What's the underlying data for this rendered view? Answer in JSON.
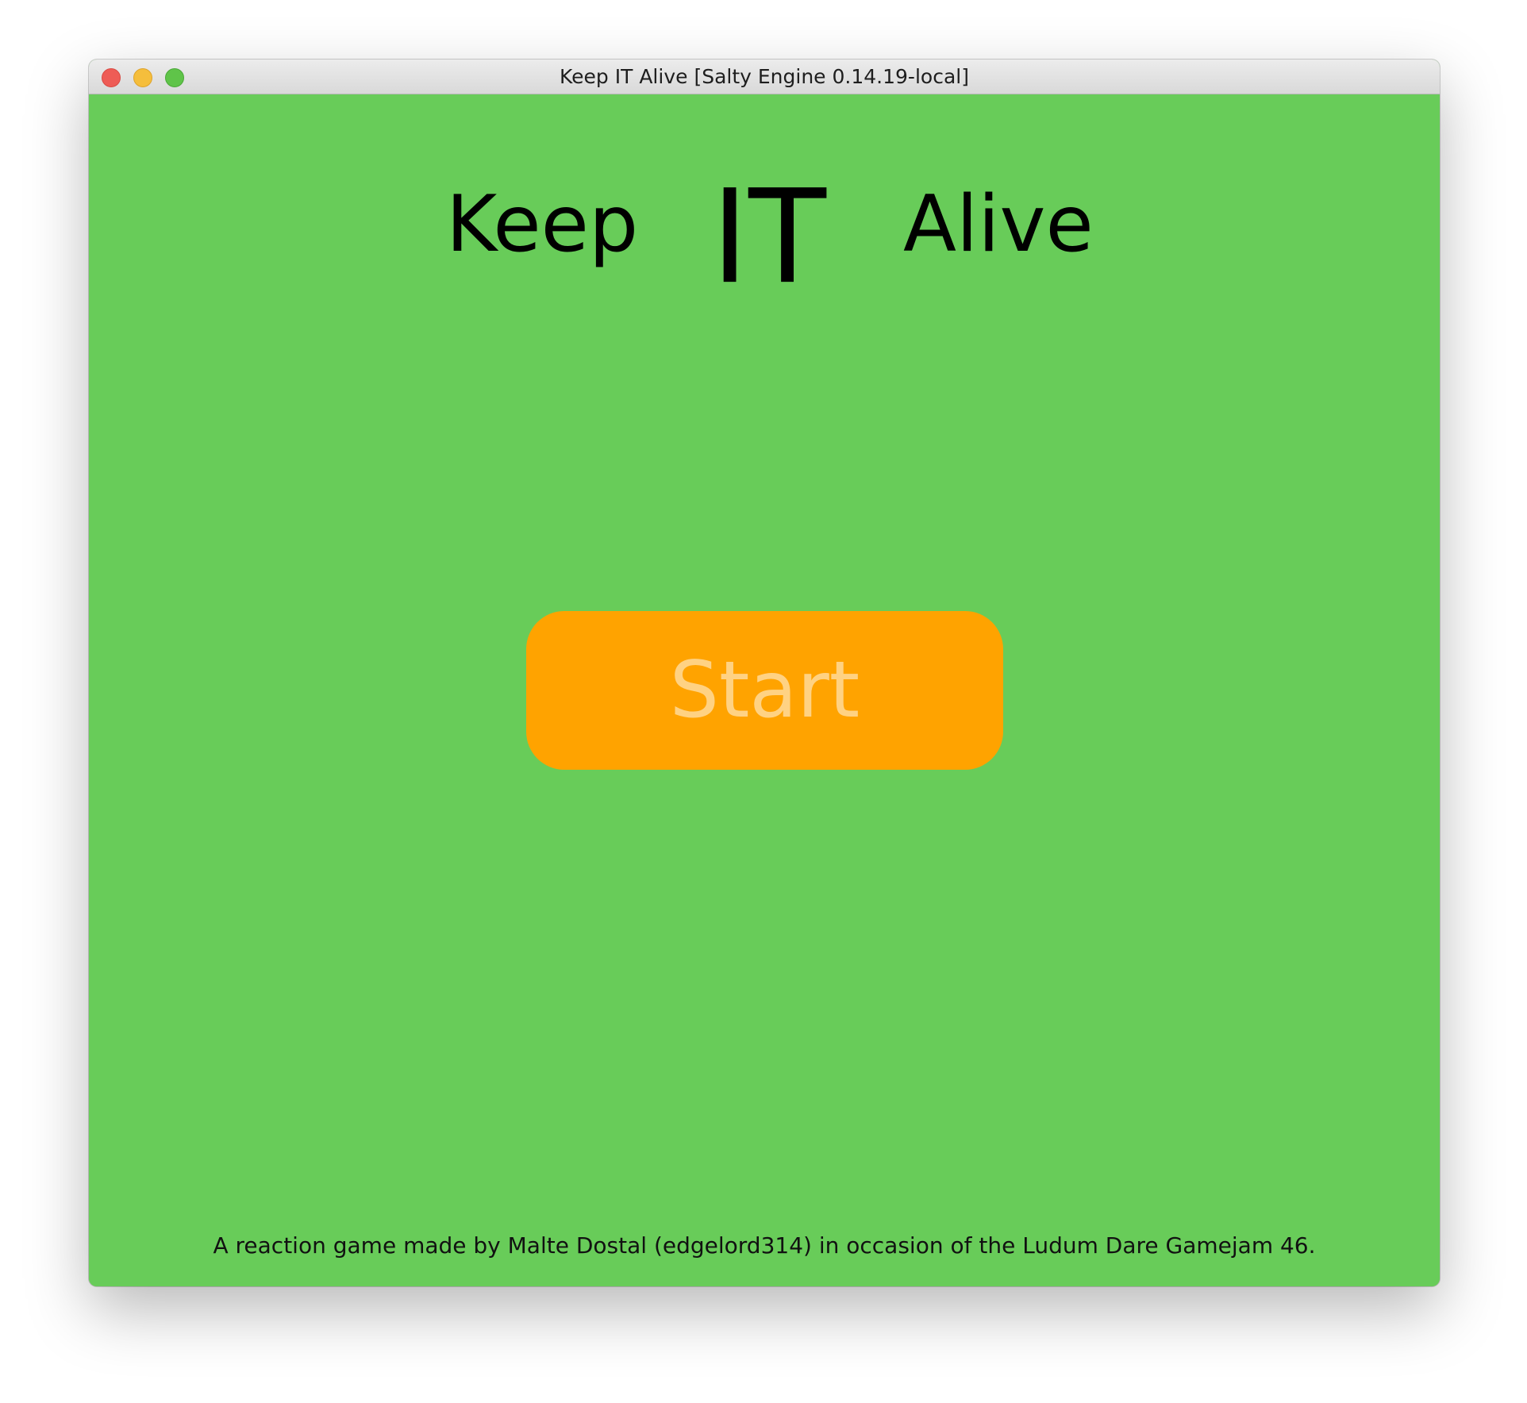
{
  "window": {
    "title": "Keep IT Alive [Salty Engine 0.14.19-local]"
  },
  "game": {
    "title_words": [
      "Keep",
      "IT",
      "Alive"
    ],
    "start_label": "Start",
    "credits": "A reaction game made by Malte Dostal (edgelord314) in occasion of the Ludum Dare Gamejam 46."
  },
  "colors": {
    "background": "#68cc59",
    "button": "#ffa300",
    "button_text": "#ffd283",
    "title_text": "#000000"
  },
  "icons": {
    "close": "close-traffic-light",
    "minimize": "minimize-traffic-light",
    "zoom": "zoom-traffic-light"
  }
}
